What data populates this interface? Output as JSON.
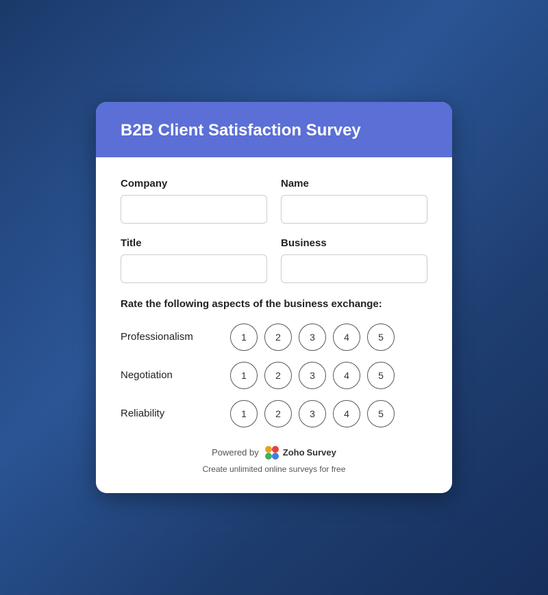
{
  "background": {
    "color": "#243d72"
  },
  "card": {
    "header": {
      "title": "B2B Client Satisfaction Survey",
      "bg_color": "#5b6fd6"
    },
    "fields": [
      {
        "label": "Company",
        "placeholder": "",
        "id": "company"
      },
      {
        "label": "Name",
        "placeholder": "",
        "id": "name"
      },
      {
        "label": "Title",
        "placeholder": "",
        "id": "title"
      },
      {
        "label": "Business",
        "placeholder": "",
        "id": "business"
      }
    ],
    "rating_section": {
      "question": "Rate the following aspects of the business exchange:",
      "aspects": [
        {
          "label": "Professionalism",
          "id": "professionalism"
        },
        {
          "label": "Negotiation",
          "id": "negotiation"
        },
        {
          "label": "Reliability",
          "id": "reliability"
        }
      ],
      "options": [
        "1",
        "2",
        "3",
        "4",
        "5"
      ]
    },
    "footer": {
      "powered_by_text": "Powered by",
      "brand_name": "Zoho",
      "product_name": "Survey",
      "tagline": "Create unlimited online surveys for free"
    }
  }
}
